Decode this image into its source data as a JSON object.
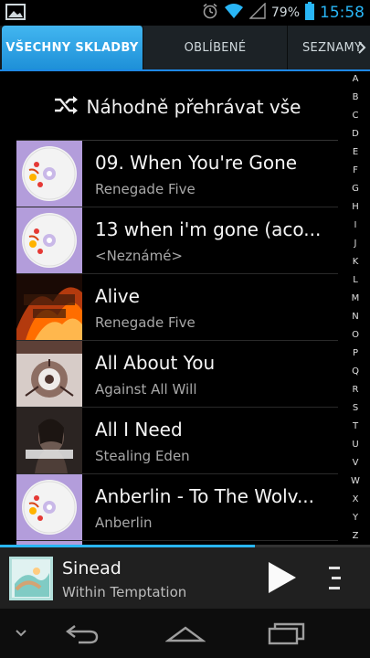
{
  "status_bar": {
    "battery_percent": "79%",
    "time": "15:58",
    "icons": [
      "gallery-notification-icon",
      "alarm-icon",
      "wifi-icon",
      "signal-icon",
      "battery-icon"
    ],
    "time_color": "#29b6f6"
  },
  "tabs": [
    {
      "label": "VŠECHNY SKLADBY",
      "active": true
    },
    {
      "label": "OBLÍBENÉ",
      "active": false
    },
    {
      "label": "SEZNAMY",
      "active": false
    }
  ],
  "shuffle": {
    "label": "Náhodně přehrávat vše",
    "icon": "shuffle-icon"
  },
  "songs": [
    {
      "title": "09. When You're Gone",
      "artist": "Renegade Five",
      "art": "default-disc-art"
    },
    {
      "title": "13 when i'm gone (aco...",
      "artist": "<Neznámé>",
      "art": "default-disc-art"
    },
    {
      "title": "Alive",
      "artist": "Renegade Five",
      "art": "renegade-five-album-art"
    },
    {
      "title": "All About You",
      "artist": "Against All Will",
      "art": "against-all-will-album-art"
    },
    {
      "title": "All I Need",
      "artist": "Stealing Eden",
      "art": "stealing-eden-album-art"
    },
    {
      "title": "Anberlin - To The Wolv...",
      "artist": "Anberlin",
      "art": "default-disc-art"
    }
  ],
  "alphabet": [
    "A",
    "B",
    "C",
    "D",
    "E",
    "F",
    "G",
    "H",
    "I",
    "J",
    "K",
    "L",
    "M",
    "N",
    "O",
    "P",
    "Q",
    "R",
    "S",
    "T",
    "U",
    "V",
    "W",
    "X",
    "Y",
    "Z"
  ],
  "now_playing": {
    "title": "Sinead",
    "artist": "Within Temptation",
    "progress": 0.69,
    "accent": "#29b6f6"
  },
  "nav_bar": {
    "icons": [
      "hide-keyboard-chevron-icon",
      "back-icon",
      "home-icon",
      "recent-apps-icon"
    ]
  }
}
